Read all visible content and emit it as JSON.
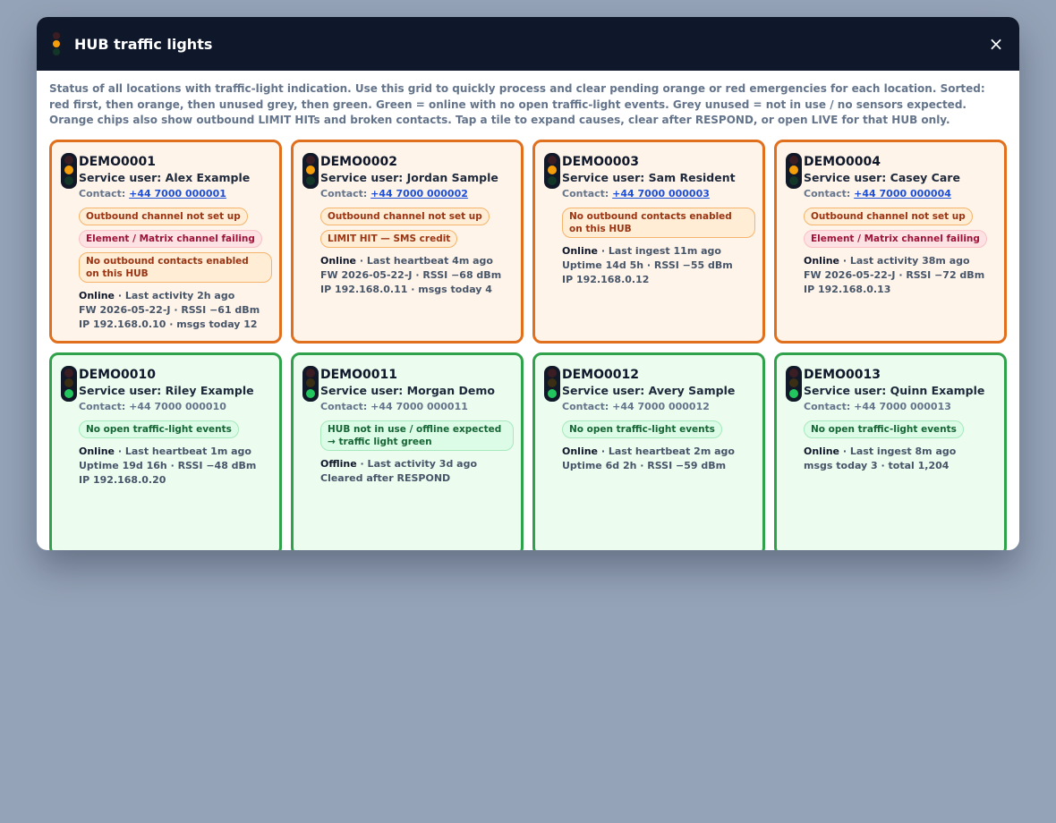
{
  "modal": {
    "title": "HUB traffic lights",
    "close_label": "×",
    "description": "Status of all locations with traffic-light indication. Use this grid to quickly process and clear pending orange or red emergencies for each location. Sorted: red first, then orange, then unused grey, then green. Green = online with no open traffic-light events. Grey unused = not in use / no sensors expected. Orange chips also show outbound LIMIT HITs and broken contacts. Tap a tile to expand causes, clear after RESPOND, or open LIVE for that HUB only."
  },
  "colors": {
    "orange_border": "#e06f1e",
    "green_border": "#31a24c",
    "lamp_amber": "#f59e0b",
    "lamp_green": "#22c55e",
    "header_bg": "#0f172a"
  },
  "tiles": [
    {
      "status": "orange",
      "id": "DEMO0001",
      "service_user": "Service user: Alex Example",
      "contact_label": "Contact:",
      "contact": "+44 7000 000001",
      "contact_link": true,
      "chips": [
        {
          "text": "Outbound channel not set up",
          "tone": "orange"
        },
        {
          "text": "Element / Matrix channel failing",
          "tone": "red"
        },
        {
          "text": "No outbound contacts enabled on this HUB",
          "tone": "orange",
          "wide": true
        }
      ],
      "state": "Online",
      "lines": [
        "· Last activity 2h ago",
        "FW 2026-05-22-J · RSSI −61 dBm",
        "IP 192.168.0.10 · msgs today 12"
      ]
    },
    {
      "status": "orange",
      "id": "DEMO0002",
      "service_user": "Service user: Jordan Sample",
      "contact_label": "Contact:",
      "contact": "+44 7000 000002",
      "contact_link": true,
      "chips": [
        {
          "text": "Outbound channel not set up",
          "tone": "orange"
        },
        {
          "text": "LIMIT HIT — SMS credit",
          "tone": "orange"
        }
      ],
      "state": "Online",
      "lines": [
        "· Last heartbeat 4m ago",
        "FW 2026-05-22-J · RSSI −68 dBm",
        "IP 192.168.0.11 · msgs today 4"
      ]
    },
    {
      "status": "orange",
      "id": "DEMO0003",
      "service_user": "Service user: Sam Resident",
      "contact_label": "Contact:",
      "contact": "+44 7000 000003",
      "contact_link": true,
      "chips": [
        {
          "text": "No outbound contacts enabled on this HUB",
          "tone": "orange",
          "wide": true
        }
      ],
      "state": "Online",
      "lines": [
        "· Last ingest 11m ago",
        "Uptime 14d 5h · RSSI −55 dBm",
        "IP 192.168.0.12"
      ]
    },
    {
      "status": "orange",
      "id": "DEMO0004",
      "service_user": "Service user: Casey Care",
      "contact_label": "Contact:",
      "contact": "+44 7000 000004",
      "contact_link": true,
      "chips": [
        {
          "text": "Outbound channel not set up",
          "tone": "orange"
        },
        {
          "text": "Element / Matrix channel failing",
          "tone": "red"
        }
      ],
      "state": "Online",
      "lines": [
        "· Last activity 38m ago",
        "FW 2026-05-22-J · RSSI −72 dBm",
        "IP 192.168.0.13"
      ]
    },
    {
      "status": "green",
      "id": "DEMO0010",
      "service_user": "Service user: Riley Example",
      "contact_label": "Contact:",
      "contact": "+44 7000 000010",
      "contact_link": false,
      "chips": [
        {
          "text": "No open traffic-light events",
          "tone": "green"
        }
      ],
      "state": "Online",
      "lines": [
        "· Last heartbeat 1m ago",
        "Uptime 19d 16h · RSSI −48 dBm",
        "IP 192.168.0.20"
      ]
    },
    {
      "status": "green",
      "id": "DEMO0011",
      "service_user": "Service user: Morgan Demo",
      "contact_label": "Contact:",
      "contact": "+44 7000 000011",
      "contact_link": false,
      "chips": [
        {
          "text": "HUB not in use / offline expected → traffic light green",
          "tone": "green",
          "wide": true
        }
      ],
      "state": "Offline",
      "lines": [
        "· Last activity 3d ago",
        "Cleared after RESPOND"
      ]
    },
    {
      "status": "green",
      "id": "DEMO0012",
      "service_user": "Service user: Avery Sample",
      "contact_label": "Contact:",
      "contact": "+44 7000 000012",
      "contact_link": false,
      "chips": [
        {
          "text": "No open traffic-light events",
          "tone": "green"
        }
      ],
      "state": "Online",
      "lines": [
        "· Last heartbeat 2m ago",
        "Uptime 6d 2h · RSSI −59 dBm"
      ]
    },
    {
      "status": "green",
      "id": "DEMO0013",
      "service_user": "Service user: Quinn Example",
      "contact_label": "Contact:",
      "contact": "+44 7000 000013",
      "contact_link": false,
      "chips": [
        {
          "text": "No open traffic-light events",
          "tone": "green"
        }
      ],
      "state": "Online",
      "lines": [
        "· Last ingest 8m ago",
        "msgs today 3 · total 1,204"
      ]
    }
  ]
}
